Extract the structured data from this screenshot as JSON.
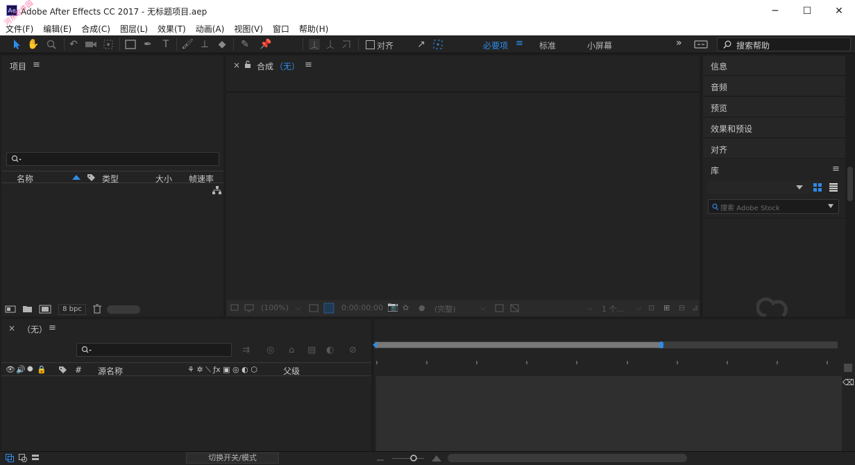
{
  "window": {
    "title": "Adobe After Effects CC 2017 - 无标题项目.aep",
    "logo": "Ae",
    "minimize": "─",
    "maximize": "☐",
    "close": "✕"
  },
  "watermark": "河东软件园",
  "menu": [
    "文件(F)",
    "编辑(E)",
    "合成(C)",
    "图层(L)",
    "效果(T)",
    "动画(A)",
    "视图(V)",
    "窗口",
    "帮助(H)"
  ],
  "toolbar": {
    "snap_label": "对齐",
    "workspaces": [
      "必要项",
      "标准",
      "小屏幕"
    ],
    "active_workspace": "必要项",
    "more": "»",
    "search_help": "搜索帮助"
  },
  "project": {
    "title": "项目",
    "search_icon": "search-icon",
    "columns": [
      "名称",
      "类型",
      "大小",
      "帧速率"
    ],
    "bpc": "8 bpc"
  },
  "composition": {
    "close": "×",
    "title": "合成",
    "name": "（无）",
    "zoom": "(100%)",
    "timecode": "0:00:00:00",
    "resolution": "(完整)",
    "views": "1 个..."
  },
  "right_panels": {
    "items": [
      "信息",
      "音频",
      "预览",
      "效果和预设",
      "对齐"
    ],
    "library_title": "库",
    "library_search_placeholder": "搜索 Adobe Stock"
  },
  "timeline": {
    "close": "×",
    "name": "（无）",
    "columns": [
      "#",
      "源名称",
      "父级"
    ]
  },
  "status": {
    "toggle_label": "切换开关/模式"
  }
}
